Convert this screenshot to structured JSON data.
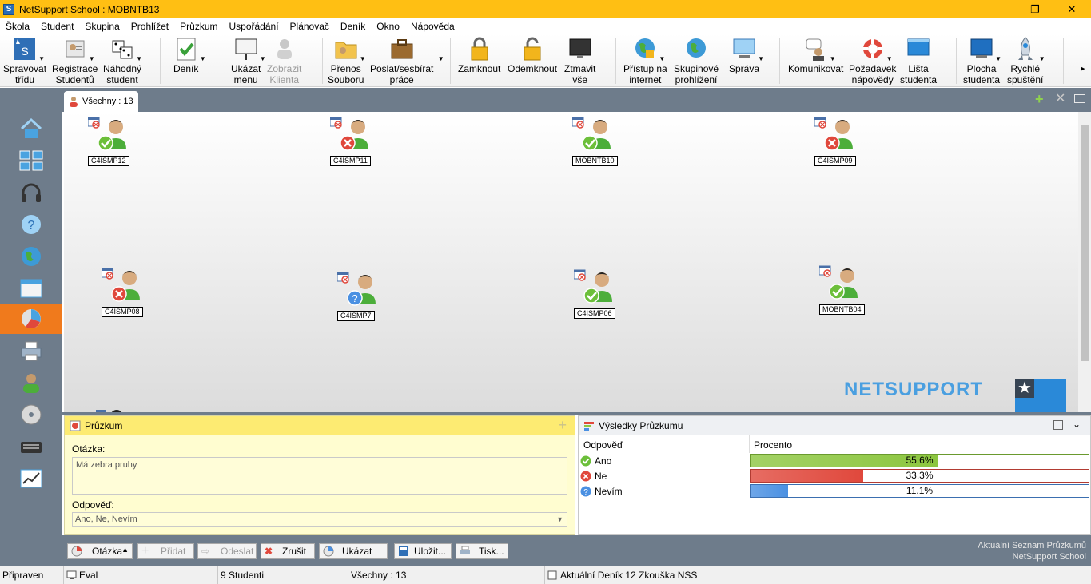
{
  "window": {
    "title": "NetSupport School : MOBNTB13",
    "minimize": "—",
    "restore": "❐",
    "close": "✕"
  },
  "menu": [
    "Škola",
    "Student",
    "Skupina",
    "Prohlížet",
    "Průzkum",
    "Uspořádání",
    "Plánovač",
    "Deník",
    "Okno",
    "Nápověda"
  ],
  "toolbar": {
    "manage": [
      "Spravovat",
      "třídu"
    ],
    "register": [
      "Registrace",
      "Studentů"
    ],
    "random": [
      "Náhodný",
      "student"
    ],
    "journal": [
      "Deník"
    ],
    "show_menu": [
      "Ukázat",
      "menu"
    ],
    "show_client": [
      "Zobrazit",
      "Klienta"
    ],
    "file_transfer": [
      "Přenos",
      "Souboru"
    ],
    "send_collect": [
      "Poslat/sesbírat",
      "práce"
    ],
    "lock": [
      "Zamknout"
    ],
    "unlock": [
      "Odemknout"
    ],
    "blank": [
      "Ztmavit",
      "vše"
    ],
    "internet": [
      "Přístup na",
      "internet"
    ],
    "group_browse": [
      "Skupinové",
      "prohlížení"
    ],
    "manage2": [
      "Správa"
    ],
    "communicate": [
      "Komunikovat"
    ],
    "help_request": [
      "Požadavek",
      "nápovědy"
    ],
    "student_bar": [
      "Lišta",
      "studenta"
    ],
    "desktop": [
      "Plocha",
      "studenta"
    ],
    "quick_launch": [
      "Rychlé",
      "spuštění"
    ],
    "more": "▸"
  },
  "tab": {
    "label": "Všechny : 13"
  },
  "students": [
    {
      "name": "C4ISMP12",
      "status": "yes"
    },
    {
      "name": "C4ISMP11",
      "status": "no"
    },
    {
      "name": "MOBNTB10",
      "status": "yes"
    },
    {
      "name": "C4ISMP09",
      "status": "no"
    },
    {
      "name": "C4ISMP08",
      "status": "no"
    },
    {
      "name": "C4ISMP7",
      "status": "unknown"
    },
    {
      "name": "C4ISMP06",
      "status": "yes"
    },
    {
      "name": "MOBNTB04",
      "status": "yes"
    }
  ],
  "logo": {
    "text": "NETSUPPORT"
  },
  "survey": {
    "title": "Průzkum",
    "question_label": "Otázka:",
    "question": "Má zebra pruhy",
    "answer_label": "Odpověď:",
    "answers": "Ano, Ne, Nevím"
  },
  "results": {
    "title": "Výsledky Průzkumu",
    "col_answer": "Odpověď",
    "col_percent": "Procento",
    "rows": [
      {
        "label": "Ano",
        "percent_text": "55.6%",
        "percent": 55.6,
        "color": "#8cc63f"
      },
      {
        "label": "Ne",
        "percent_text": "33.3%",
        "percent": 33.3,
        "color": "#e0483c"
      },
      {
        "label": "Nevím",
        "percent_text": "11.1%",
        "percent": 11.1,
        "color": "#4a90e2"
      }
    ]
  },
  "bottom_toolbar": {
    "question": "Otázka",
    "add": "Přidat",
    "send": "Odeslat",
    "cancel": "Zrušit",
    "show": "Ukázat",
    "save": "Uložit...",
    "print": "Tisk...",
    "right_line1": "Aktuální Seznam Průzkumů",
    "right_line2": "NetSupport School"
  },
  "status": {
    "ready": "Připraven",
    "eval": "Eval",
    "students": "9 Studenti",
    "all": "Všechny : 13",
    "journal": "Aktuální Deník 12 Zkouška NSS"
  }
}
